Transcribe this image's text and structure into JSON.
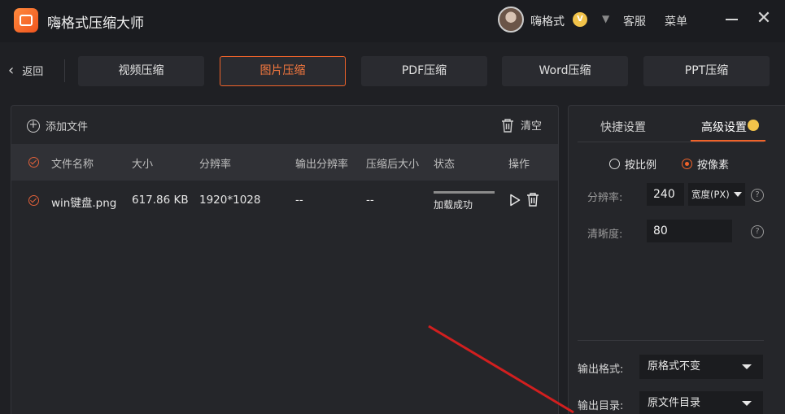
{
  "app": {
    "title": "嗨格式压缩大师",
    "logo_icon": "app-logo-icon"
  },
  "user": {
    "name": "嗨格式",
    "vip": "V",
    "service": "客服",
    "menu": "菜单"
  },
  "window": {
    "minimize": "—",
    "close": "✕"
  },
  "nav": {
    "back_label": "返回",
    "tabs": [
      {
        "label": "视频压缩",
        "active": false
      },
      {
        "label": "图片压缩",
        "active": true
      },
      {
        "label": "PDF压缩",
        "active": false
      },
      {
        "label": "Word压缩",
        "active": false
      },
      {
        "label": "PPT压缩",
        "active": false
      }
    ]
  },
  "toolbar": {
    "add_file": "添加文件",
    "clear": "清空"
  },
  "table": {
    "headers": {
      "name": "文件名称",
      "size": "大小",
      "resolution": "分辨率",
      "out_resolution": "输出分辨率",
      "out_size": "压缩后大小",
      "status": "状态",
      "actions": "操作"
    },
    "rows": [
      {
        "name": "win键盘.png",
        "size": "617.86 KB",
        "resolution": "1920*1028",
        "out_resolution": "--",
        "out_size": "--",
        "status": "加载成功",
        "progress": 1.0
      }
    ]
  },
  "settings": {
    "tabs": {
      "quick": "快捷设置",
      "advanced": "高级设置"
    },
    "mode": {
      "by_ratio": "按比例",
      "by_pixel": "按像素",
      "selected": "by_pixel"
    },
    "resolution_label": "分辨率:",
    "resolution_value": "240",
    "unit": "宽度(PX)",
    "clarity_label": "清晰度:",
    "clarity_value": "80",
    "help": "?",
    "output_format_label": "输出格式:",
    "output_format_value": "原格式不变",
    "output_dir_label": "输出目录:",
    "output_dir_value": "原文件目录"
  },
  "colors": {
    "accent": "#f0632a",
    "vip": "#f2c34a",
    "arrow": "#d21f1f"
  }
}
